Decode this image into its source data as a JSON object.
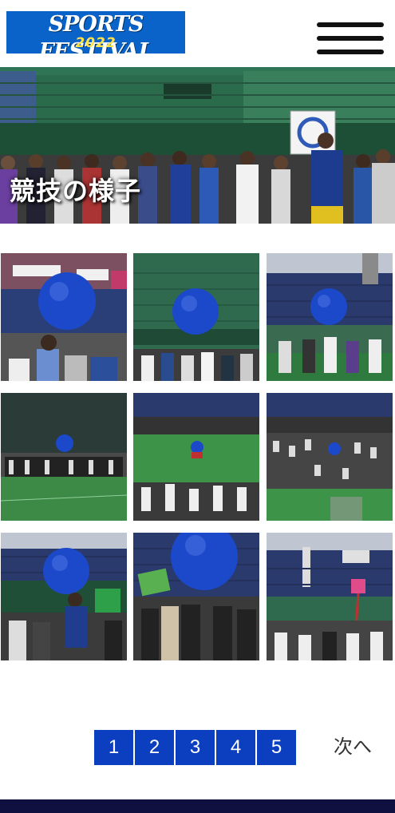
{
  "header": {
    "logo_main": "SPORTS FESTIVAL",
    "logo_year": "2022",
    "menu_icon": "hamburger-menu-icon"
  },
  "hero": {
    "title": "競技の様子"
  },
  "gallery": {
    "photos": [
      {
        "description": "blue-ball-over-crowd"
      },
      {
        "description": "blue-ball-lifted-by-hands"
      },
      {
        "description": "blue-ball-crowd-stands"
      },
      {
        "description": "small-ball-field-wide"
      },
      {
        "description": "field-wide-teams"
      },
      {
        "description": "field-wide-crowd"
      },
      {
        "description": "ball-and-player-25"
      },
      {
        "description": "ball-over-players"
      },
      {
        "description": "pink-marker-stands"
      }
    ]
  },
  "pagination": {
    "pages": [
      "1",
      "2",
      "3",
      "4",
      "5"
    ],
    "next_label": "次へ"
  },
  "colors": {
    "logo_bg": "#0a63c9",
    "logo_year": "#ffe14a",
    "page_button": "#0b3fbf",
    "footer": "#101040"
  }
}
